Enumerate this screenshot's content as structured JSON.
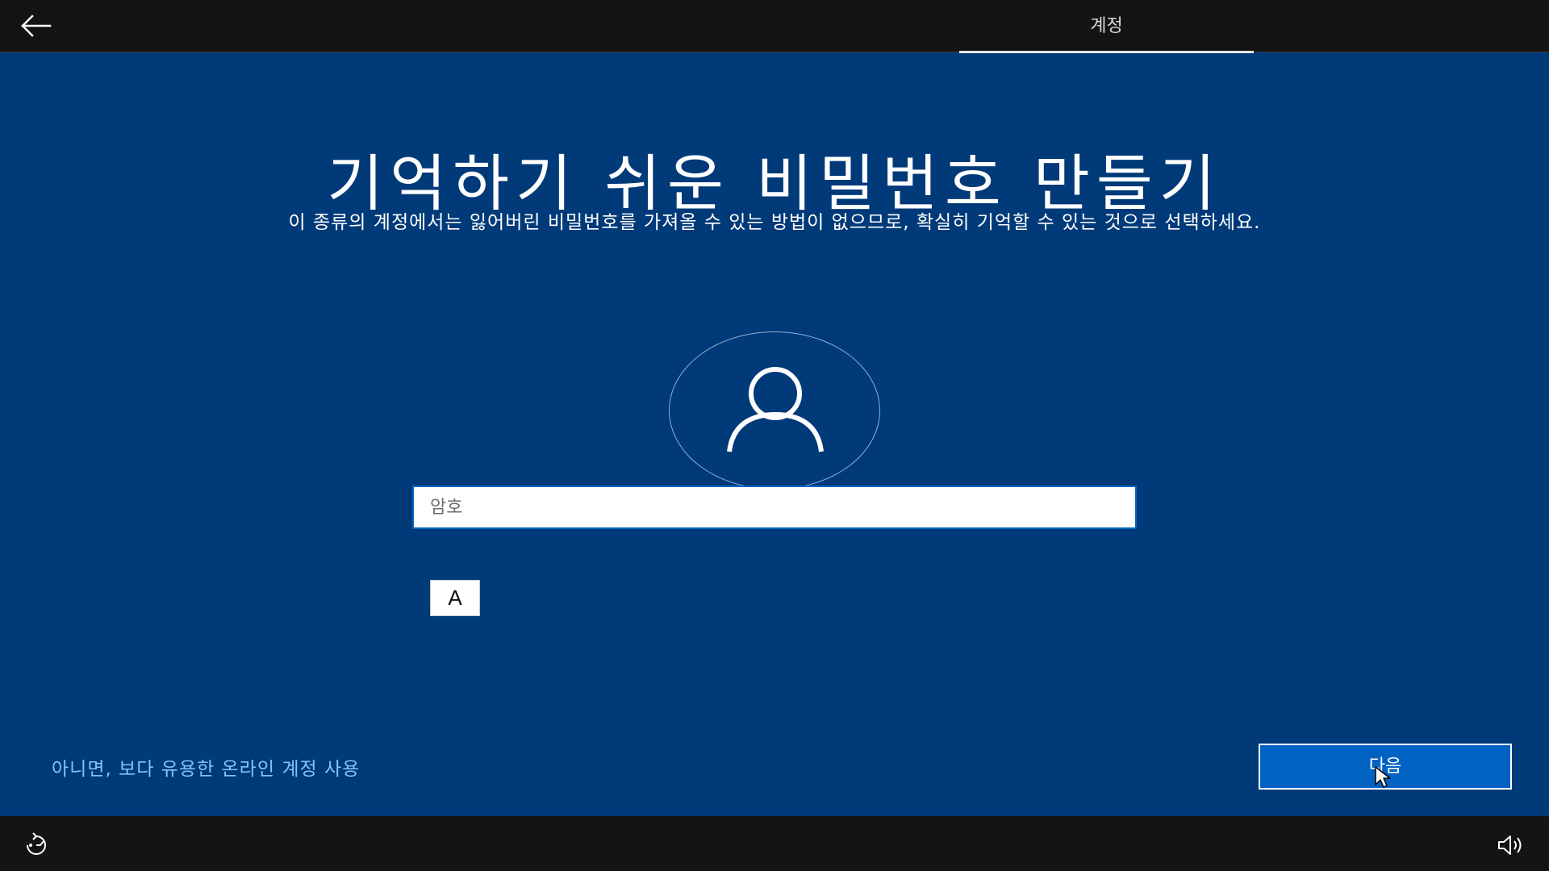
{
  "header": {
    "back_icon": "arrow-left-icon",
    "tab_label": "계정"
  },
  "main": {
    "title": "기억하기 쉬운 비밀번호 만들기",
    "subtitle": "이 종류의 계정에서는 잃어버린 비밀번호를 가져올 수 있는 방법이 없으므로, 확실히 기억할 수 있는 것으로 선택하세요.",
    "avatar_icon": "user-icon",
    "password": {
      "placeholder": "암호",
      "value": ""
    },
    "ime_indicator": "A",
    "alt_link": "아니면, 보다 유용한 온라인 계정 사용",
    "next_label": "다음"
  },
  "footer": {
    "ease_of_access_icon": "ease-of-access-icon",
    "volume_icon": "volume-icon"
  },
  "colors": {
    "background": "#003a78",
    "bars": "#141414",
    "accent": "#0063c4",
    "link": "#7fc4ff"
  }
}
